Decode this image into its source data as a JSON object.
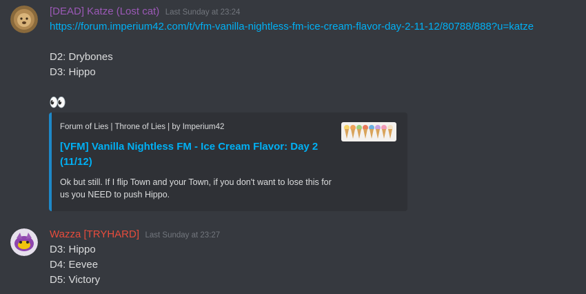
{
  "messages": [
    {
      "username": "[DEAD] Katze (Lost cat)",
      "username_color": "#9b59b6",
      "timestamp": "Last Sunday at 23:24",
      "avatar_icon": "lion-avatar-icon",
      "link": "https://forum.imperium42.com/t/vfm-vanilla-nightless-fm-ice-cream-flavor-day-2-11-12/80788/888?u=katze",
      "lines": [
        "D2: Drybones",
        "D3: Hippo"
      ],
      "emoji": "👀",
      "embed": {
        "provider": "Forum of Lies | Throne of Lies | by Imperium42",
        "title": "[VFM] Vanilla Nightless FM - Ice Cream Flavor: Day 2 (11/12)",
        "description": "Ok but still. If I flip Town and your Town, if you don't want to lose this for us you NEED to push Hippo.",
        "thumbnail_icon": "ice-cream-cones-thumbnail",
        "accent_color": "#1e88c8"
      }
    },
    {
      "username": "Wazza [TRYHARD]",
      "username_color": "#e74c3c",
      "timestamp": "Last Sunday at 23:27",
      "avatar_icon": "purple-creature-avatar-icon",
      "lines": [
        "D3: Hippo",
        "D4: Eevee",
        "D5: Victory"
      ]
    }
  ]
}
